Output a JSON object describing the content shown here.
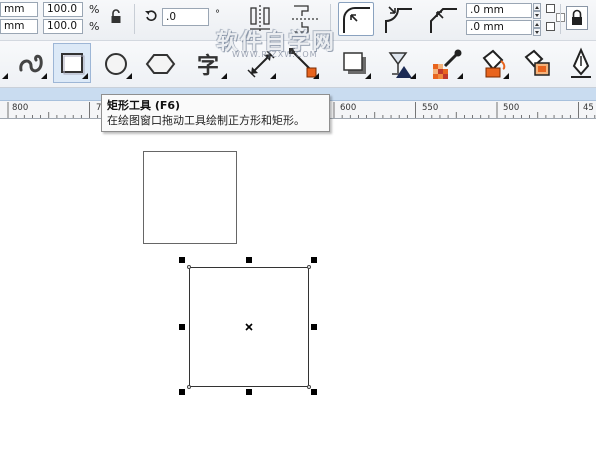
{
  "propbar": {
    "x_value": "mm",
    "y_value": "mm",
    "scale_x": "100.0",
    "scale_y": "100.0",
    "percent_symbol": "%",
    "rotation_value": ".0",
    "degree_symbol": "°",
    "corner_radius_top": ".0 mm",
    "corner_radius_bottom": ".0 mm"
  },
  "tools": [
    {
      "name": "freehand-tool",
      "active": false
    },
    {
      "name": "rectangle-tool",
      "active": true
    },
    {
      "name": "ellipse-tool",
      "active": false
    },
    {
      "name": "polygon-tool",
      "active": false
    },
    {
      "name": "text-tool",
      "active": false
    },
    {
      "name": "dimension-tool",
      "active": false
    },
    {
      "name": "connector-tool",
      "active": false
    },
    {
      "name": "dropshadow-tool",
      "active": false
    },
    {
      "name": "transparency-tool",
      "active": false
    },
    {
      "name": "eyedropper-tool",
      "active": false
    },
    {
      "name": "fill-tool",
      "active": false
    },
    {
      "name": "smart-fill-tool",
      "active": false
    },
    {
      "name": "outline-pen-tool",
      "active": false
    }
  ],
  "ruler": {
    "labels": [
      "800",
      "7",
      "600",
      "550",
      "500",
      "45"
    ]
  },
  "tooltip": {
    "title": "矩形工具 (F6)",
    "description": "在绘图窗口拖动工具绘制正方形和矩形。"
  },
  "watermark": {
    "text": "软件自学网",
    "url": "WWW.RJZXW.COM"
  },
  "colors": {
    "accent_blue": "#c9dcf0",
    "selection_handle": "#000000",
    "tool_active_bg": "#dce9f7"
  }
}
